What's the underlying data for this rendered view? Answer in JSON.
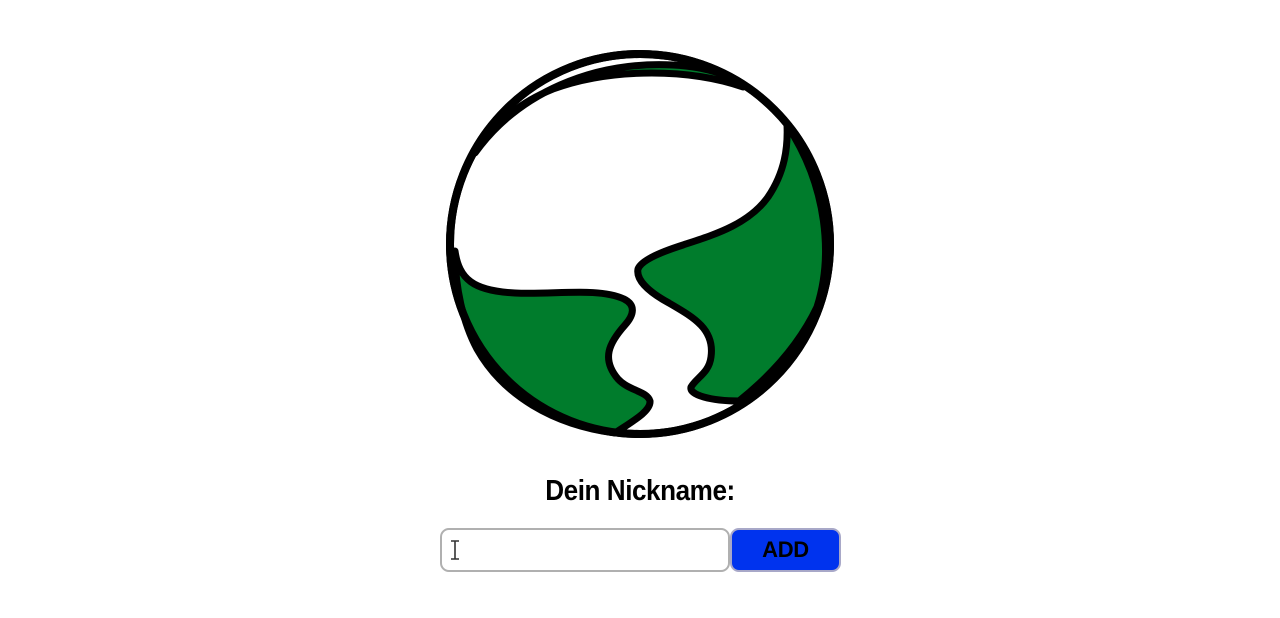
{
  "logo": {
    "icon": "globe-logo-icon",
    "colors": {
      "land": "#007c2c",
      "outline": "#000000",
      "background": "#ffffff"
    }
  },
  "form": {
    "title": "Dein Nickname:",
    "nickname_value": "",
    "nickname_placeholder": "",
    "add_label": "ADD",
    "colors": {
      "add_button": "#0033ee",
      "input_border": "#b0b0b0"
    }
  }
}
